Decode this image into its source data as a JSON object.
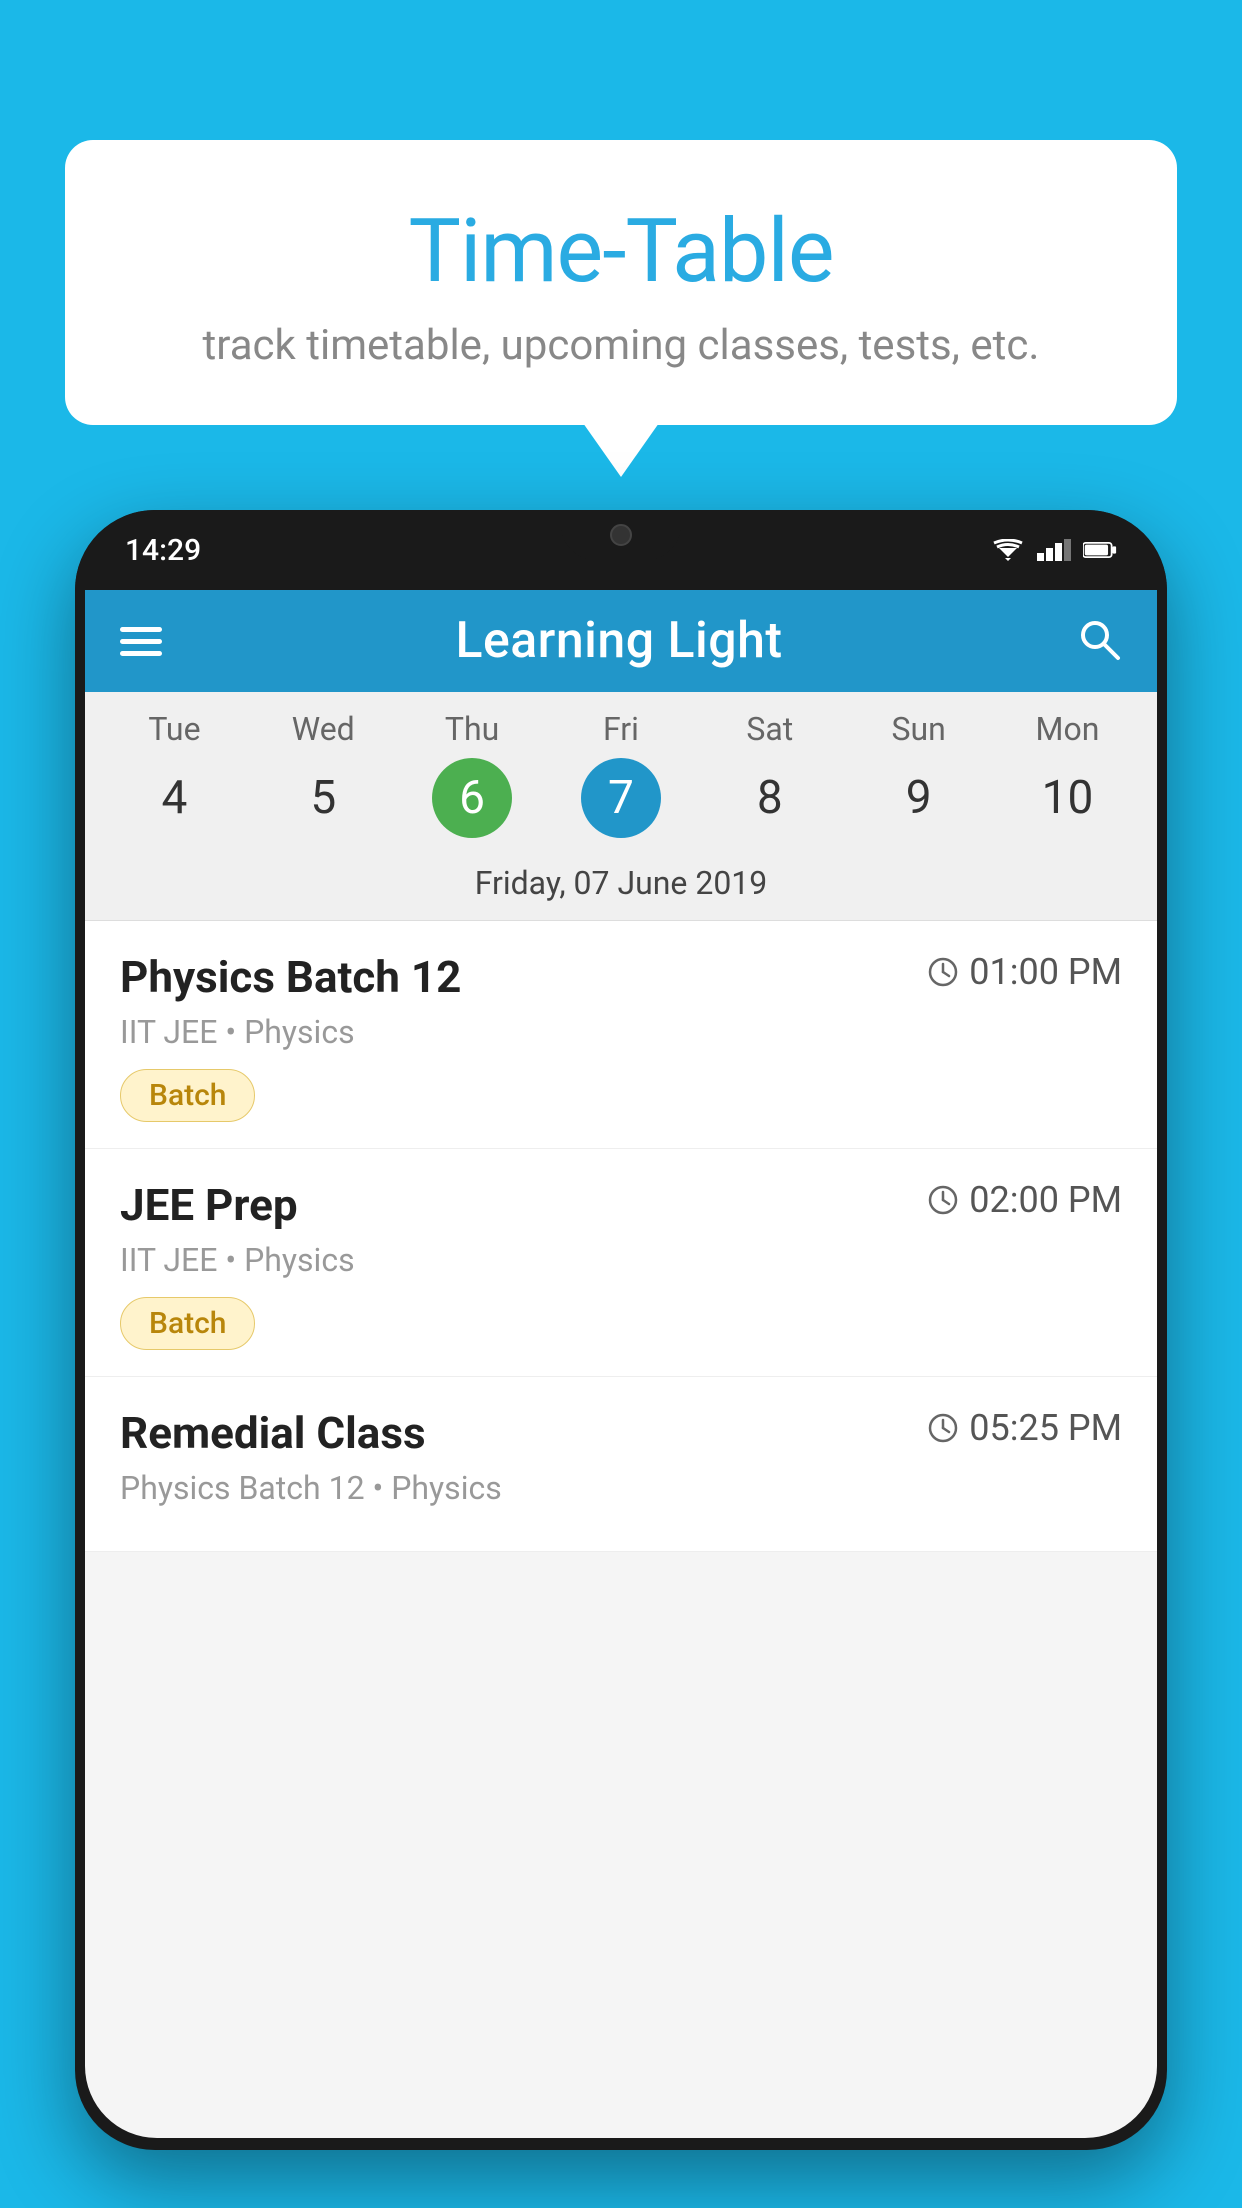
{
  "background_color": "#1BB8E8",
  "bubble": {
    "title": "Time-Table",
    "subtitle": "track timetable, upcoming classes, tests, etc."
  },
  "phone": {
    "status_bar": {
      "time": "14:29"
    },
    "app_header": {
      "title": "Learning Light"
    },
    "calendar": {
      "days": [
        {
          "name": "Tue",
          "num": "4",
          "state": "normal"
        },
        {
          "name": "Wed",
          "num": "5",
          "state": "normal"
        },
        {
          "name": "Thu",
          "num": "6",
          "state": "today"
        },
        {
          "name": "Fri",
          "num": "7",
          "state": "selected"
        },
        {
          "name": "Sat",
          "num": "8",
          "state": "normal"
        },
        {
          "name": "Sun",
          "num": "9",
          "state": "normal"
        },
        {
          "name": "Mon",
          "num": "10",
          "state": "normal"
        }
      ],
      "selected_date_label": "Friday, 07 June 2019"
    },
    "schedule": [
      {
        "title": "Physics Batch 12",
        "time": "01:00 PM",
        "meta": "IIT JEE • Physics",
        "badge": "Batch"
      },
      {
        "title": "JEE Prep",
        "time": "02:00 PM",
        "meta": "IIT JEE • Physics",
        "badge": "Batch"
      },
      {
        "title": "Remedial Class",
        "time": "05:25 PM",
        "meta": "Physics Batch 12 • Physics",
        "badge": null
      }
    ]
  }
}
